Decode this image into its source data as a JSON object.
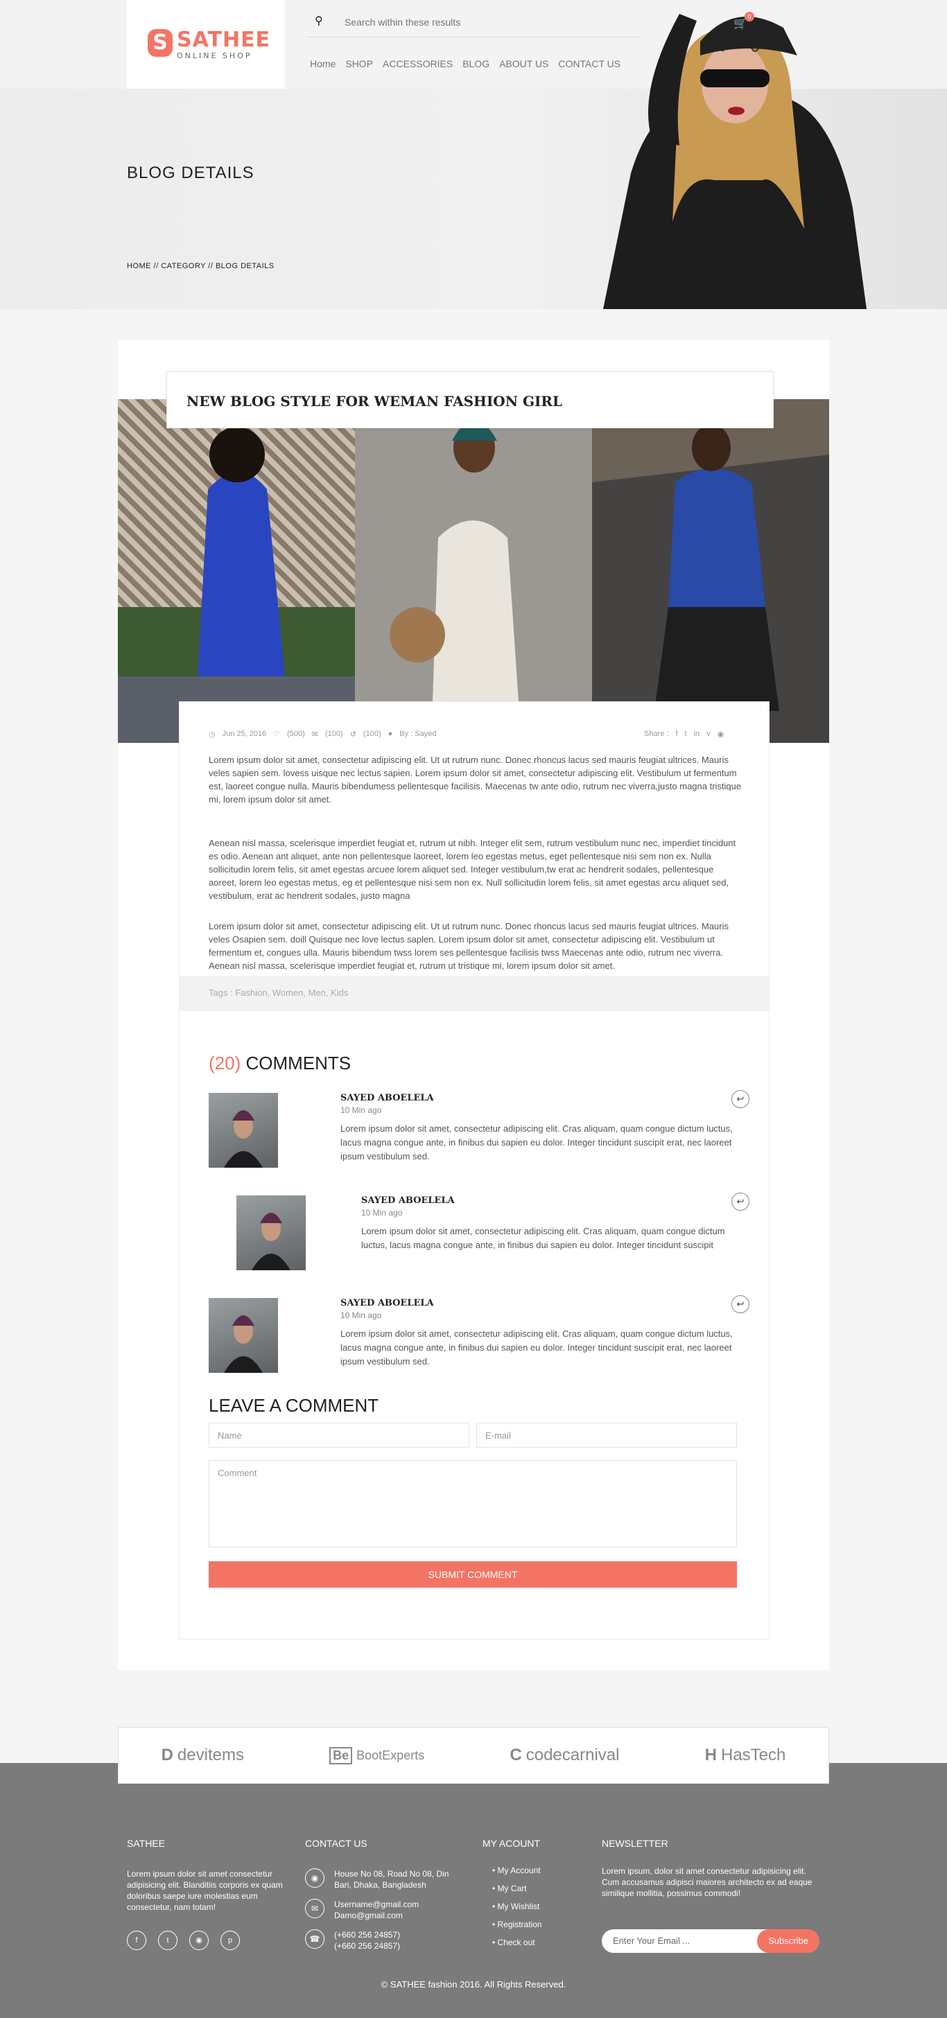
{
  "header": {
    "logo_letter": "S",
    "logo_name": "SATHEE",
    "logo_sub": "ONLINE SHOP",
    "search_placeholder": "Search within these results",
    "nav": [
      "Home",
      "SHOP",
      "ACCESSORIES",
      "BLOG",
      "ABOUT US",
      "CONTACT US"
    ],
    "cart_count": "0"
  },
  "hero": {
    "title": "BLOG DETAILS",
    "breadcrumb": "HOME  //  CATEGORY //  BLOG DETAILS"
  },
  "post": {
    "title": "NEW BLOG STYLE FOR WEMAN FASHION GIRL",
    "date": "Jun 25, 2016",
    "likes": "(500)",
    "comments": "(100)",
    "shares": "(100)",
    "author": "By : Sayed",
    "share_label": "Share :",
    "paragraphs": [
      "Lorem ipsum dolor sit amet, consectetur adipiscing elit. Ut ut rutrum nunc. Donec rhoncus lacus sed mauris feugiat ultrices. Mauris veles sapien sem. lovess uisque nec lectus sapien. Lorem ipsum dolor sit amet, consectetur adipiscing elit. Vestibulum ut fermentum est, laoreet congue nulla. Mauris bibendumess pellentesque facilisis. Maecenas tw ante odio, rutrum nec viverra,justo magna tristique mi, lorem ipsum dolor sit amet.",
      "Aenean nisl massa, scelerisque imperdiet feugiat et, rutrum ut nibh. Integer elit sem, rutrum vestibulum nunc nec, imperdiet tincidunt es odio. Aenean ant aliquet, ante non pellentesque laoreet, lorem leo egestas metus, eget pellentesque nisi sem non ex. Nulla sollicitudin lorem felis, sit amet egestas arcuee lorem aliquet sed. Integer vestibulum,tw erat ac hendrerit sodales, pellentesque aoreet, lorem leo egestas metus, eg et pellentesque nisi sem non ex. Null sollicitudin lorem felis, sit amet egestas arcu aliquet sed, vestibulum, erat ac hendrerit sodales, justo magna",
      "Lorem ipsum dolor sit amet, consectetur adipiscing elit. Ut ut rutrum nunc. Donec rhoncus lacus sed mauris feugiat ultrices. Mauris veles Osapien sem. doill Quisque nec love lectus saplen. Lorem ipsum dolor sit amet, consectetur adipiscing elit. Vestibulum ut fermentum et, congues ulla. Mauris bibendum twss lorem ses pellentesque facilisis twss Maecenas ante odio, rutrum nec viverra. Aenean nisl massa, scelerisque imperdiet feugiat et, rutrum ut tristique mi, lorem ipsum dolor sit amet."
    ],
    "tags_label": "Tags :",
    "tags": "Fashion, Women, Men, Kids"
  },
  "comments": {
    "count": "(20)",
    "heading": "COMMENTS",
    "items": [
      {
        "name": "SAYED ABOELELA",
        "time": "10 Min ago",
        "text": "Lorem ipsum dolor sit amet, consectetur adipiscing elit. Cras aliquam, quam congue dictum luctus, lacus magna congue ante, in finibus dui sapien eu dolor. Integer tincidunt suscipit erat, nec laoreet ipsum vestibulum sed."
      },
      {
        "name": "SAYED ABOELELA",
        "time": "10 Min ago",
        "text": "Lorem ipsum dolor sit amet, consectetur adipiscing elit. Cras aliquam, quam congue dictum luctus, lacus magna congue ante, in finibus dui sapien eu dolor. Integer tincidunt suscipit"
      },
      {
        "name": "SAYED ABOELELA",
        "time": "10 Min ago",
        "text": "Lorem ipsum dolor sit amet, consectetur adipiscing elit. Cras aliquam, quam congue dictum luctus, lacus magna congue ante, in finibus dui sapien eu dolor. Integer tincidunt suscipit erat, nec laoreet ipsum vestibulum sed."
      }
    ]
  },
  "form": {
    "heading": "LEAVE A COMMENT",
    "name_placeholder": "Name",
    "email_placeholder": "E-mail",
    "comment_placeholder": "Comment",
    "submit": "SUBMIT COMMENT"
  },
  "brands": [
    "devitems",
    "BootExperts",
    "codecarnival",
    "HasTech"
  ],
  "brand_marks": [
    "D",
    "Be",
    "C",
    "H"
  ],
  "footer": {
    "about_title": "SATHEE",
    "about_text": "Lorem ipsum dolor sit amet consectetur adipisicing elit. Blanditiis corporis ex quam doloribus saepe iure molestias eum consectetur, nam totam!",
    "contact_title": "CONTACT US",
    "address": "House No 08, Road No 08, Din Bari, Dhaka, Bangladesh",
    "emails": "Username@gmail.com\nDamo@gmail.com",
    "phones": "(+660 256 24857)\n(+660 256 24857)",
    "account_title": "MY ACOUNT",
    "account_links": [
      "My Account",
      "My Cart",
      "My Wishlist",
      "Registration",
      "Check out"
    ],
    "newsletter_title": "NEWSLETTER",
    "newsletter_text": "Lorem ipsum, dolor sit amet consectetur adipisicing elit. Cum accusamus adipisci maiores architecto ex ad eaque similique mollitia, possimus commodi!",
    "email_placeholder": "Enter Your Email ...",
    "subscribe": "Subscribe",
    "copyright": "© SATHEE fashion 2016. All Rights Reserved."
  },
  "colors": {
    "accent": "#f47464",
    "footer_bg": "#7b7b7b"
  }
}
